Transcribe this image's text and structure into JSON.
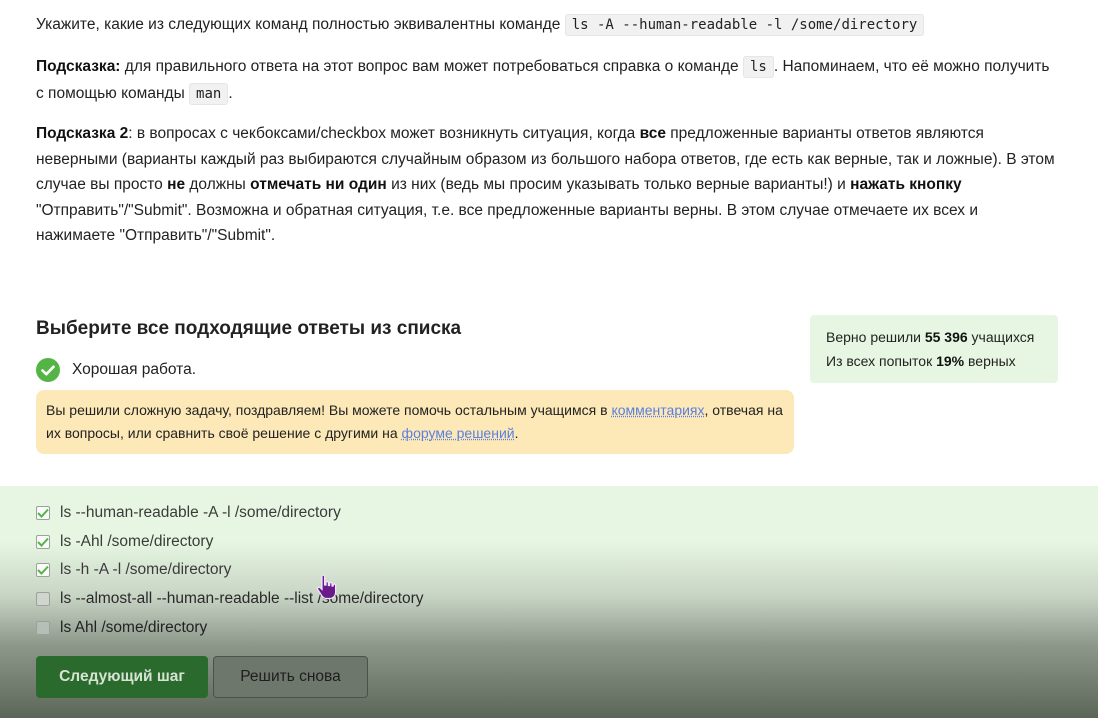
{
  "question": {
    "intro": "Укажите, какие из следующих команд полностью эквивалентны команде",
    "command": "ls -A --human-readable -l /some/directory",
    "hint1_label": "Подсказка:",
    "hint1_text_a": "для правильного ответа на этот вопрос вам может потребоваться справка о команде",
    "hint1_code_a": "ls",
    "hint1_text_b": ". Напоминаем, что её можно получить с помощью команды",
    "hint1_code_b": "man",
    "hint1_text_c": ".",
    "hint2_label": "Подсказка 2",
    "hint2_t1": ": в вопросах с чекбоксами/checkbox может возникнуть ситуация, когда",
    "hint2_b1": "все",
    "hint2_t2": "предложенные варианты ответов являются неверными (варианты каждый раз выбираются случайным образом из большого набора ответов, где есть как верные, так и ложные). В этом случае вы просто",
    "hint2_b2": "не",
    "hint2_t3": "должны",
    "hint2_b3": "отмечать ни один",
    "hint2_t4": "из них (ведь мы просим указывать только верные варианты!) и",
    "hint2_b4": "нажать кнопку",
    "hint2_t5": "\"Отправить\"/\"Submit\". Возможна и обратная ситуация, т.е. все предложенные варианты верны. В этом случае отмечаете их всех и нажимаете \"Отправить\"/\"Submit\"."
  },
  "section_title": "Выберите все подходящие ответы из списка",
  "stats": {
    "solved_prefix": "Верно решили",
    "solved_count": "55 396",
    "solved_suffix": "учащихся",
    "attempts_prefix": "Из всех попыток",
    "attempts_percent": "19%",
    "attempts_suffix": "верных"
  },
  "feedback": {
    "icon": "check-circle-icon",
    "text": "Хорошая работа."
  },
  "notice": {
    "t1": "Вы решили сложную задачу, поздравляем! Вы можете помочь остальным учащимся в",
    "link1": "комментариях",
    "t2": ", отвечая на их вопросы, или сравнить своё решение с другими на",
    "link2": "форуме решений",
    "t3": "."
  },
  "options": [
    {
      "label": "ls --human-readable -A  -l /some/directory",
      "checked": true
    },
    {
      "label": "ls -Ahl /some/directory",
      "checked": true
    },
    {
      "label": "ls -h -A -l /some/directory",
      "checked": true
    },
    {
      "label": "ls --almost-all --human-readable --list /some/directory",
      "checked": false
    },
    {
      "label": "ls Ahl /some/directory",
      "checked": false
    }
  ],
  "buttons": {
    "next": "Следующий шаг",
    "retry": "Решить снова"
  },
  "colors": {
    "success_green": "#54b546",
    "panel_green": "#e7f6e3",
    "notice_yellow": "#fde9b7",
    "link_blue": "#5a7fe0",
    "next_button": "#2a6a2c"
  }
}
